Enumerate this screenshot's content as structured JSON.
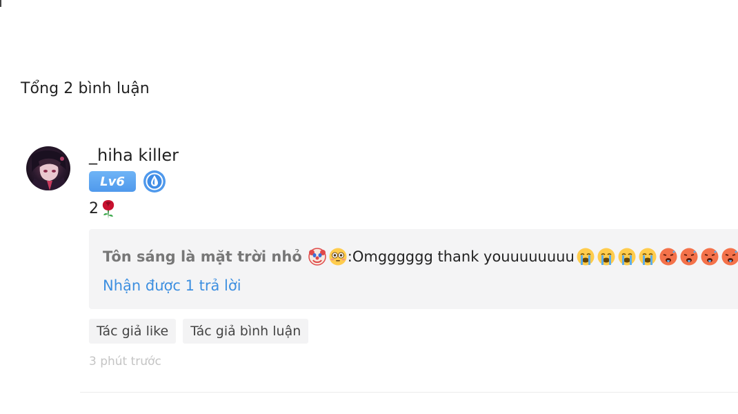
{
  "header": {
    "total_label": "Tổng 2 bình luận"
  },
  "comment": {
    "username": "_hiha killer",
    "level_badge": "Lv6",
    "medal_icon": "water-drop-medal-icon",
    "text": "2",
    "text_emoji": "rose-icon",
    "reply": {
      "author": "Tôn sáng là mặt trời nhỏ",
      "author_emojis": [
        "clown-face-icon",
        "flushed-face-icon"
      ],
      "separator": ":",
      "content": " Omgggggg thank youuuuuuuu",
      "content_emojis": [
        "loudly-crying-face-icon",
        "loudly-crying-face-icon",
        "loudly-crying-face-icon",
        "loudly-crying-face-icon",
        "hot-face-icon",
        "hot-face-icon",
        "hot-face-icon",
        "hot-face-icon"
      ],
      "reply_count_label": "Nhận được 1 trả lời"
    },
    "tags": [
      "Tác giả like",
      "Tác giả bình luận"
    ],
    "timestamp": "3 phút trước"
  },
  "colors": {
    "accent_blue": "#3d8fe0",
    "level_badge_bg": "#5aa3f0",
    "reply_bg": "#f4f4f5",
    "muted_text": "#c4c4c4"
  }
}
